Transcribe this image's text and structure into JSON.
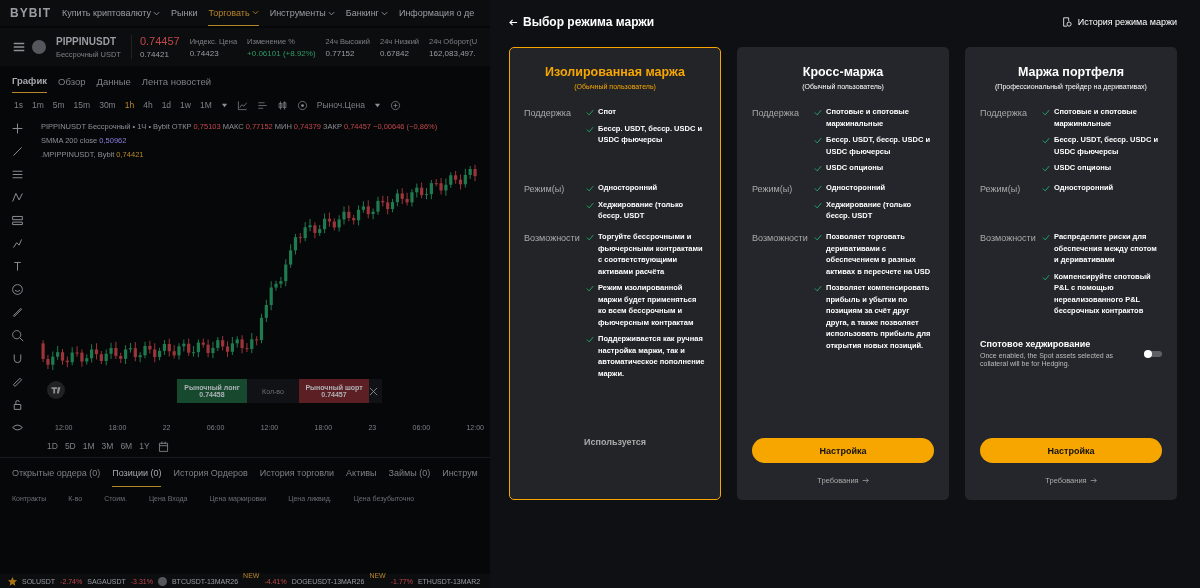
{
  "background": {
    "logo": "BYBIT",
    "nav": [
      {
        "label": "Купить криптовалюту",
        "dropdown": true,
        "selected": false
      },
      {
        "label": "Рынки",
        "dropdown": false,
        "selected": false
      },
      {
        "label": "Торговать",
        "dropdown": true,
        "selected": true
      },
      {
        "label": "Инструменты",
        "dropdown": true,
        "selected": false
      },
      {
        "label": "Банкинг",
        "dropdown": true,
        "selected": false
      },
      {
        "label": "Информация о де",
        "dropdown": false,
        "selected": false
      }
    ],
    "ticker": {
      "symbol": "PIPPINUSDT",
      "subtitle": "Бессрочный USDT",
      "price": "0.74457",
      "mark_price": "0.74421",
      "stats": [
        {
          "label": "Индекс. Цена",
          "value": "0.74423",
          "positive": false
        },
        {
          "label": "Изменение %",
          "value": "+0.06101 (+8.92%)",
          "positive": true
        },
        {
          "label": "24ч Высокий",
          "value": "0.77152",
          "positive": false
        },
        {
          "label": "24ч Низкий",
          "value": "0.67842",
          "positive": false
        },
        {
          "label": "24ч Оборот(U",
          "value": "162,083,497.",
          "positive": false
        }
      ]
    },
    "chart_tabs": [
      {
        "label": "График",
        "selected": true
      },
      {
        "label": "Обзор",
        "selected": false
      },
      {
        "label": "Данные",
        "selected": false
      },
      {
        "label": "Лента новостей",
        "selected": false
      }
    ],
    "timeframes": [
      {
        "label": "1s",
        "selected": false
      },
      {
        "label": "1m",
        "selected": false
      },
      {
        "label": "5m",
        "selected": false
      },
      {
        "label": "15m",
        "selected": false
      },
      {
        "label": "30m",
        "selected": false
      },
      {
        "label": "1h",
        "selected": true
      },
      {
        "label": "4h",
        "selected": false
      },
      {
        "label": "1d",
        "selected": false
      },
      {
        "label": "1w",
        "selected": false
      },
      {
        "label": "1M",
        "selected": false
      }
    ],
    "price_type": "Рыноч.Цена",
    "legend": {
      "title": "PIPPINUSDT Бессрочный • 1Ч • Bybit",
      "ohlc": [
        {
          "label": "ОТКР",
          "value": "0,75103"
        },
        {
          "label": "МАКС",
          "value": "0,77152"
        },
        {
          "label": "МИН",
          "value": "0,74379"
        },
        {
          "label": "ЗАКР",
          "value": "0,74457"
        }
      ],
      "change": "−0,00646 (−0,86%)",
      "indicator": "SMMA 200 close",
      "indicator_value": "0,50962",
      "mark_series": ".MPIPPINUSDT, Bybit",
      "mark_value": "0,74421"
    },
    "order_bar": {
      "long_label": "Рыночный лонг",
      "long_price": "0.74458",
      "quantity_placeholder": "Кол-во",
      "short_label": "Рыночный шорт",
      "short_price": "0.74457"
    },
    "time_axis": [
      "12:00",
      "18:00",
      "22",
      "06:00",
      "12:00",
      "18:00",
      "23",
      "06:00",
      "12:00"
    ],
    "ranges": [
      "1D",
      "5D",
      "1M",
      "3M",
      "6M",
      "1Y"
    ],
    "bottom_tabs": [
      {
        "label": "Открытые ордера (0)",
        "selected": false
      },
      {
        "label": "Позиции (0)",
        "selected": true
      },
      {
        "label": "История Ордеров",
        "selected": false
      },
      {
        "label": "История торговли",
        "selected": false
      },
      {
        "label": "Активы",
        "selected": false
      },
      {
        "label": "Займы (0)",
        "selected": false
      },
      {
        "label": "Инструм",
        "selected": false
      }
    ],
    "columns": [
      "Контракты",
      "К-во",
      "Стоим.",
      "Цена Входа",
      "Цена маркировки",
      "Цена ликвид.",
      "Цена безубыточно"
    ],
    "market_strip": [
      {
        "symbol": "SOLUSDT",
        "change": "-2.74%"
      },
      {
        "symbol": "SAGAUSDT",
        "change": "-3.31%"
      },
      {
        "symbol": "BTCUSDT-13MAR26",
        "badge": "NEW",
        "change": "-4.41%"
      },
      {
        "symbol": "DOGEUSDT-13MAR26",
        "badge": "NEW",
        "change": "-1.77%"
      },
      {
        "symbol": "ETHUSDT-13MAR2"
      }
    ]
  },
  "panel": {
    "title": "Выбор режима маржи",
    "history_link": "История режима маржи",
    "cards": [
      {
        "title": "Изолированная маржа",
        "subtitle": "(Обычный пользователь)",
        "selected": true,
        "sections": [
          {
            "label": "Поддержка",
            "items": [
              "Спот",
              "Бесср. USDT, бесср. USDC и USDC фьючерсы"
            ]
          },
          {
            "label": "Режим(ы)",
            "items": [
              "Односторонний",
              "Хеджирование (только бесср. USDT"
            ]
          },
          {
            "label": "Возможности",
            "items": [
              "Торгуйте бессрочными и фьючерсными контрактами с соответствующими активами расчёта",
              "Режим изолированной маржи будет применяться ко всем бессрочным и фьючерсным контрактам",
              "Поддерживается как ручная настройка маржи, так и автоматическое пополнение маржи."
            ]
          }
        ],
        "status": "Используется"
      },
      {
        "title": "Кросс-маржа",
        "subtitle": "(Обычный пользователь)",
        "selected": false,
        "sections": [
          {
            "label": "Поддержка",
            "items": [
              "Спотовые и спотовые маржинальные",
              "Бесср. USDT, бесср. USDC и USDC фьючерсы",
              "USDC опционы"
            ]
          },
          {
            "label": "Режим(ы)",
            "items": [
              "Односторонний",
              "Хеджирование (только бесср. USDT"
            ]
          },
          {
            "label": "Возможности",
            "items": [
              "Позволяет торговать деривативами с обеспечением в разных активах в пересчете на USD",
              "Позволяет компенсировать прибыль и убытки по позициям за счёт друг друга, а также позволяет использовать прибыль для открытия новых позиций."
            ]
          }
        ],
        "button": "Настройка",
        "requirements_link": "Требования"
      },
      {
        "title": "Маржа портфеля",
        "subtitle": "(Профессиональный трейдер на деривативах)",
        "selected": false,
        "sections": [
          {
            "label": "Поддержка",
            "items": [
              "Спотовые и спотовые маржинальные",
              "Бесср. USDT, бесср. USDC и USDC фьючерсы",
              "USDC опционы"
            ]
          },
          {
            "label": "Режим(ы)",
            "items": [
              "Односторонний"
            ]
          },
          {
            "label": "Возможности",
            "items": [
              "Распределите риски для обеспечения между спотом и деривативами",
              "Компенсируйте спотовый P&L с помощью нереализованного P&L бессрочных контрактов"
            ]
          }
        ],
        "hedging": {
          "title": "Спотовое хеджирование",
          "description": "Once enabled, the Spot assets selected as collateral will be for Hedging.",
          "on": false
        },
        "button": "Настройка",
        "requirements_link": "Требования"
      }
    ]
  }
}
